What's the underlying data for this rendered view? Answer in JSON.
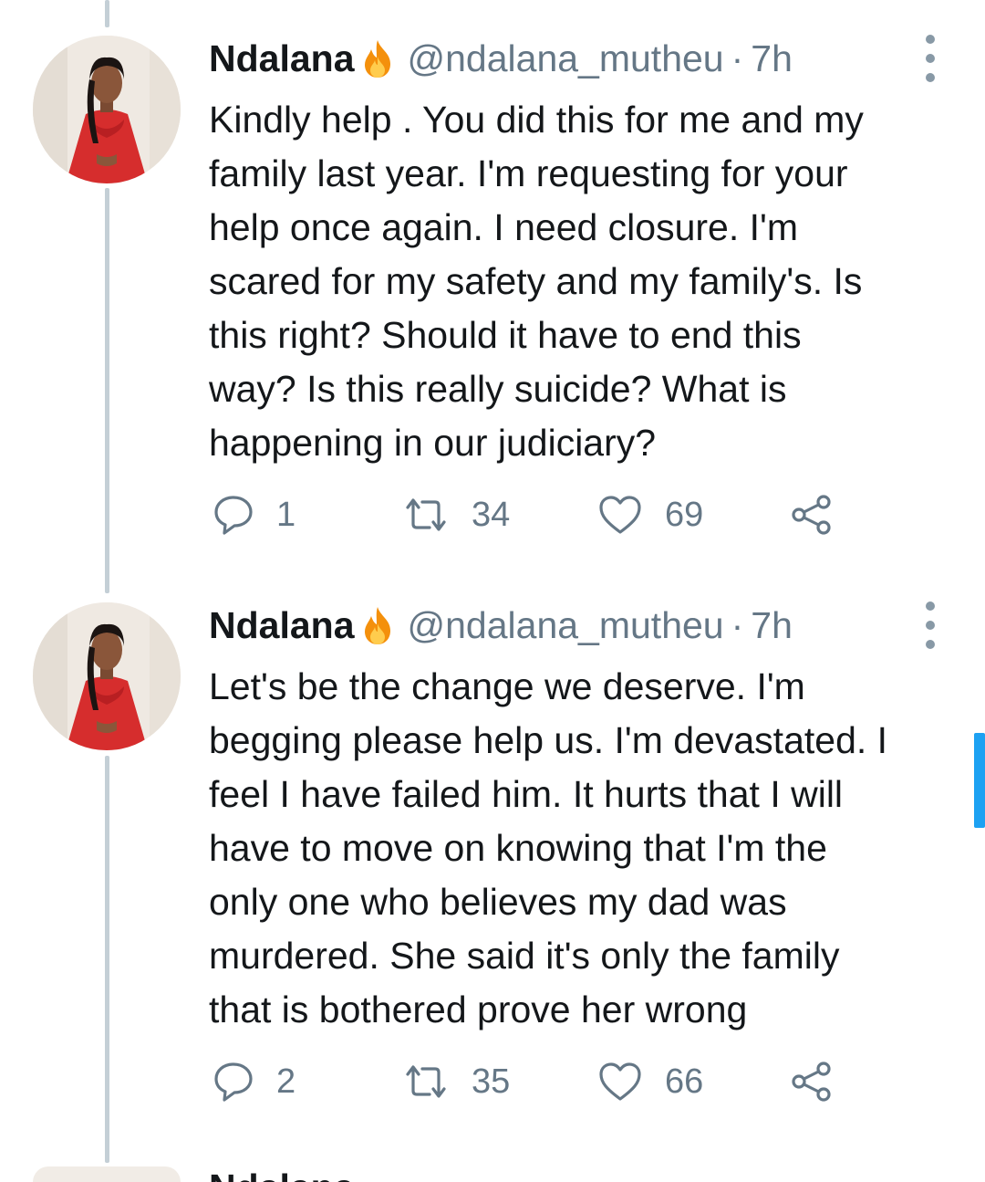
{
  "tweets": [
    {
      "name": "Ndalana",
      "handle": "@ndalana_mutheu",
      "separator": "·",
      "time": "7h",
      "text": "Kindly help . You did this for me and my\nfamily last year. I'm requesting for your\nhelp once again. I need closure. I'm\nscared for my safety and my family's. Is\nthis right?  Should it have to end this\nway? Is this really suicide? What is\nhappening in our judiciary?",
      "replies": "1",
      "retweets": "34",
      "likes": "69"
    },
    {
      "name": "Ndalana",
      "handle": "@ndalana_mutheu",
      "separator": "·",
      "time": "7h",
      "text": "Let's be the change we deserve. I'm\nbegging please help us. I'm devastated. I\nfeel I have failed him. It hurts that I will\nhave to move on knowing that I'm the\nonly one who believes my dad was\nmurdered. She said it's only the family\nthat is bothered prove her wrong",
      "replies": "2",
      "retweets": "35",
      "likes": "66"
    }
  ],
  "partial_tweet": {
    "name": "Ndalana"
  },
  "icons": {
    "name_badge": "fire-emoji",
    "reply": "reply-icon",
    "retweet": "retweet-icon",
    "like": "heart-icon",
    "share": "share-icon",
    "more": "more-options-icon"
  },
  "colors": {
    "text": "#14171a",
    "secondary": "#657786",
    "thread_line": "#c4cfd6",
    "accent": "#1da1f2",
    "avatar_dress": "#d62d2d"
  }
}
